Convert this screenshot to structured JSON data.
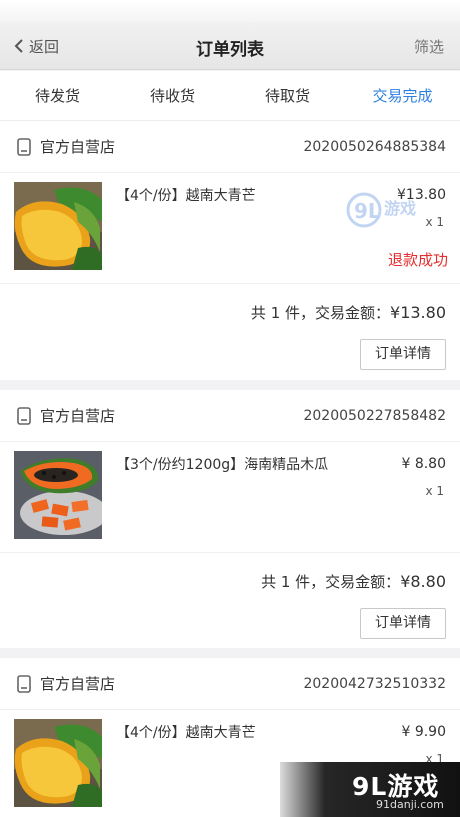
{
  "nav": {
    "back_label": "返回",
    "title": "订单列表",
    "filter_label": "筛选"
  },
  "tabs": [
    {
      "label": "待发货",
      "active": false
    },
    {
      "label": "待收货",
      "active": false
    },
    {
      "label": "待取货",
      "active": false
    },
    {
      "label": "交易完成",
      "active": true
    }
  ],
  "orders": [
    {
      "shop": "官方自营店",
      "order_no": "2020050264885384",
      "item_title": "【4个/份】越南大青芒",
      "image": "mango-image",
      "price": "¥13.80",
      "qty": "x 1",
      "status": "退款成功",
      "summary_prefix": "共 1 件，交易金额：",
      "summary_amount": "¥13.80",
      "detail_button": "订单详情"
    },
    {
      "shop": "官方自营店",
      "order_no": "2020050227858482",
      "item_title": "【3个/份约1200g】海南精品木瓜",
      "image": "papaya-image",
      "price": "¥ 8.80",
      "qty": "x 1",
      "status": "",
      "summary_prefix": "共 1 件，交易金额：",
      "summary_amount": "¥8.80",
      "detail_button": "订单详情"
    },
    {
      "shop": "官方自营店",
      "order_no": "2020042732510332",
      "item_title": "【4个/份】越南大青芒",
      "image": "mango-image",
      "price": "¥ 9.90",
      "qty": "x 1"
    }
  ],
  "watermark": {
    "logo": "9L游戏",
    "url": "91danji.com"
  },
  "colors": {
    "accent": "#2d7fe0",
    "refund_red": "#e42d2d"
  }
}
